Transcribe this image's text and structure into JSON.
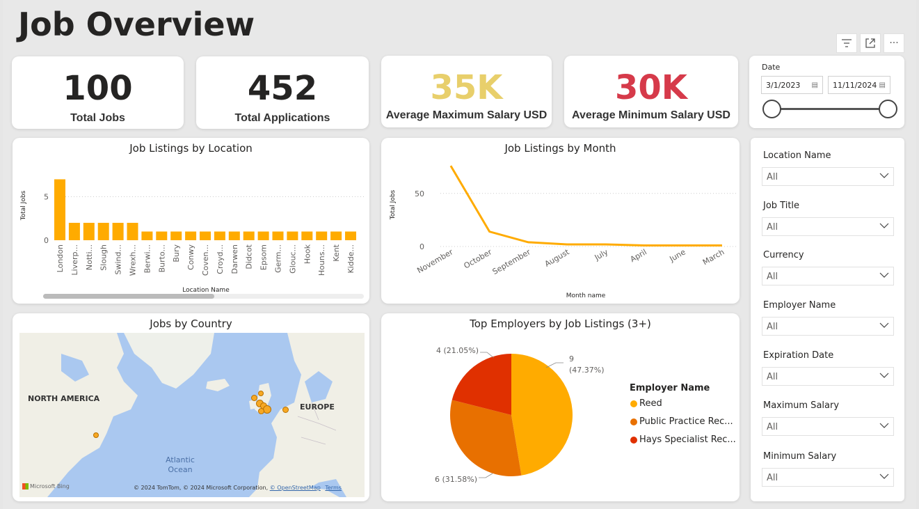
{
  "page": {
    "title": "Job Overview"
  },
  "toolbar": {
    "filter_icon": "filter-icon",
    "focus_icon": "focus-mode-icon",
    "more_icon": "more-options-icon",
    "more_label": "···"
  },
  "kpis": [
    {
      "value": "100",
      "label": "Total Jobs",
      "color": "#252423"
    },
    {
      "value": "452",
      "label": "Total Applications",
      "color": "#252423"
    },
    {
      "value": "35K",
      "label": "Average Maximum Salary USD",
      "color": "#e8cf6b"
    },
    {
      "value": "30K",
      "label": "Average Minimum Salary USD",
      "color": "#d63a4a"
    }
  ],
  "date_slicer": {
    "label": "Date",
    "start": "3/1/2023",
    "end": "11/11/2024"
  },
  "slicers": [
    {
      "label": "Location Name",
      "value": "All"
    },
    {
      "label": "Job Title",
      "value": "All"
    },
    {
      "label": "Currency",
      "value": "All"
    },
    {
      "label": "Employer Name",
      "value": "All"
    },
    {
      "label": "Expiration Date",
      "value": "All"
    },
    {
      "label": "Maximum Salary",
      "value": "All"
    },
    {
      "label": "Minimum Salary",
      "value": "All"
    }
  ],
  "map": {
    "title": "Jobs by Country",
    "labels": {
      "north_america": "NORTH AMERICA",
      "europe": "EUROPE",
      "ocean": "Atlantic Ocean",
      "bing": "Microsoft Bing",
      "copyright": "© 2024 TomTom, © 2024 Microsoft Corporation,",
      "osm": "© OpenStreetMap",
      "terms": "Terms"
    }
  },
  "chart_data": [
    {
      "type": "bar",
      "title": "Job Listings by Location",
      "xlabel": "Location Name",
      "ylabel": "Total Jobs",
      "categories": [
        "London",
        "Liverp...",
        "Notti...",
        "Slough",
        "Swind...",
        "Wrexh...",
        "Berwi...",
        "Burto...",
        "Bury",
        "Conwy",
        "Coven...",
        "Croyd...",
        "Darwen",
        "Didcot",
        "Epsom",
        "Germ...",
        "Glouc...",
        "Hook",
        "Houns...",
        "Kent",
        "Kidde..."
      ],
      "values": [
        7,
        2,
        2,
        2,
        2,
        2,
        1,
        1,
        1,
        1,
        1,
        1,
        1,
        1,
        1,
        1,
        1,
        1,
        1,
        1,
        1
      ],
      "yticks": [
        0,
        5
      ],
      "ylim": [
        0,
        8
      ],
      "color": "#ffab00"
    },
    {
      "type": "line",
      "title": "Job Listings by Month",
      "xlabel": "Month name",
      "ylabel": "Total Jobs",
      "categories": [
        "November",
        "October",
        "September",
        "August",
        "July",
        "April",
        "June",
        "March"
      ],
      "values": [
        76,
        14,
        4,
        2,
        2,
        1,
        1,
        1
      ],
      "yticks": [
        0,
        50
      ],
      "ylim": [
        0,
        80
      ],
      "color": "#ffab00"
    },
    {
      "type": "pie",
      "title": "Top Employers by Job Listings (3+)",
      "legend_title": "Employer Name",
      "series": [
        {
          "name": "Reed",
          "value": 9,
          "label": "9",
          "pct": "(47.37%)",
          "color": "#ffab00"
        },
        {
          "name": "Public Practice Rec...",
          "value": 6,
          "label": "6 (31.58%)",
          "pct": "",
          "color": "#e87000"
        },
        {
          "name": "Hays Specialist Rec...",
          "value": 4,
          "label": "4 (21.05%)",
          "pct": "",
          "color": "#e03000"
        }
      ]
    }
  ]
}
